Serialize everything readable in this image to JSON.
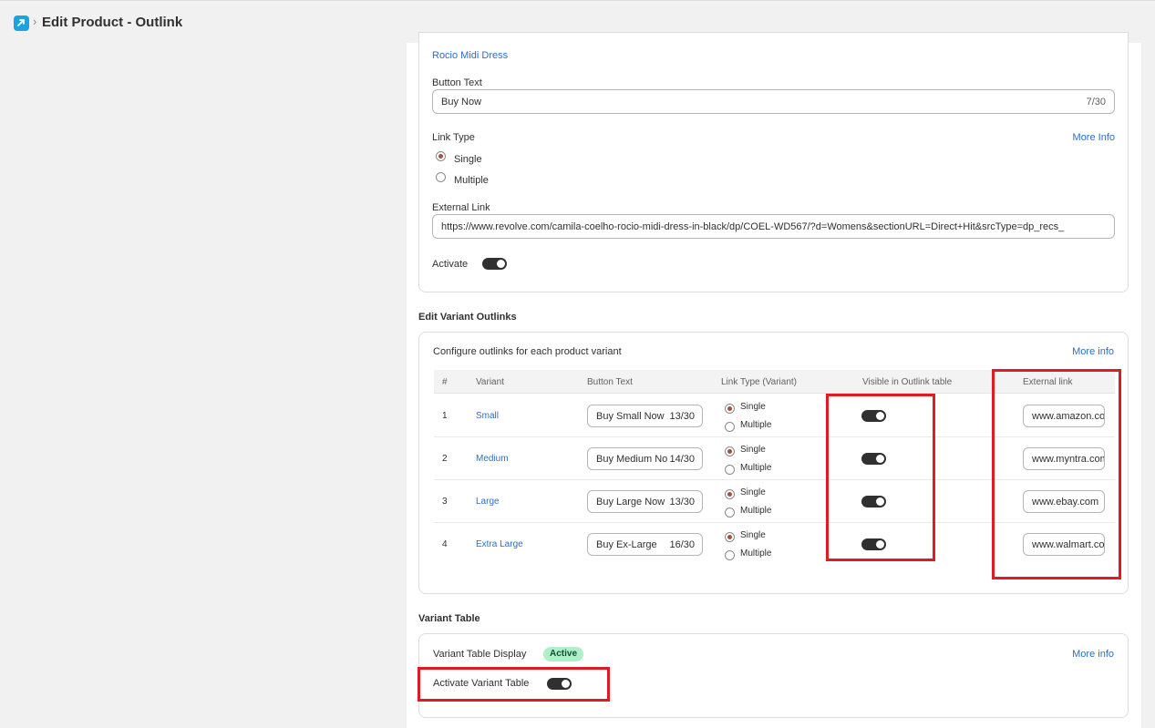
{
  "header": {
    "title": "Edit Product - Outlink",
    "app_icon": "app-icon",
    "chevron": "›"
  },
  "product": {
    "name": "Rocio Midi Dress",
    "button_text_label": "Button Text",
    "button_text_value": "Buy Now",
    "button_text_count": "7/30",
    "link_type_label": "Link Type",
    "more_info": "More Info",
    "link_type_options": [
      "Single",
      "Multiple"
    ],
    "link_type_selected": "Single",
    "external_link_label": "External Link",
    "external_link_value": "https://www.revolve.com/camila-coelho-rocio-midi-dress-in-black/dp/COEL-WD567/?d=Womens&sectionURL=Direct+Hit&srcType=dp_recs_",
    "activate_label": "Activate",
    "activate_on": true
  },
  "variants": {
    "section_title": "Edit Variant Outlinks",
    "description": "Configure outlinks for each product variant",
    "more_info": "More info",
    "columns": [
      "#",
      "Variant",
      "Button Text",
      "Link Type (Variant)",
      "Visible in Outlink table",
      "External link"
    ],
    "rows": [
      {
        "num": "1",
        "variant": "Small",
        "button_text": "Buy Small Now",
        "count": "13/30",
        "single": "Single",
        "multiple": "Multiple",
        "selected": "Single",
        "visible": true,
        "link": "www.amazon.com"
      },
      {
        "num": "2",
        "variant": "Medium",
        "button_text": "Buy Medium Now",
        "count": "14/30",
        "single": "Single",
        "multiple": "Multiple",
        "selected": "Single",
        "visible": true,
        "link": "www.myntra.com"
      },
      {
        "num": "3",
        "variant": "Large",
        "button_text": "Buy Large Now",
        "count": "13/30",
        "single": "Single",
        "multiple": "Multiple",
        "selected": "Single",
        "visible": true,
        "link": "www.ebay.com"
      },
      {
        "num": "4",
        "variant": "Extra Large",
        "button_text": "Buy Ex-Large",
        "count": "16/30",
        "single": "Single",
        "multiple": "Multiple",
        "selected": "Single",
        "visible": true,
        "link": "www.walmart.com"
      }
    ]
  },
  "variant_table": {
    "section_title": "Variant Table",
    "display_label": "Variant Table Display",
    "status_badge": "Active",
    "more_info": "More info",
    "activate_label": "Activate Variant Table",
    "activate_on": true
  },
  "colors": {
    "link": "#2c6ecb",
    "highlight": "#e01b24",
    "badge_bg": "#aff0c8",
    "toggle_on": "#303030"
  }
}
